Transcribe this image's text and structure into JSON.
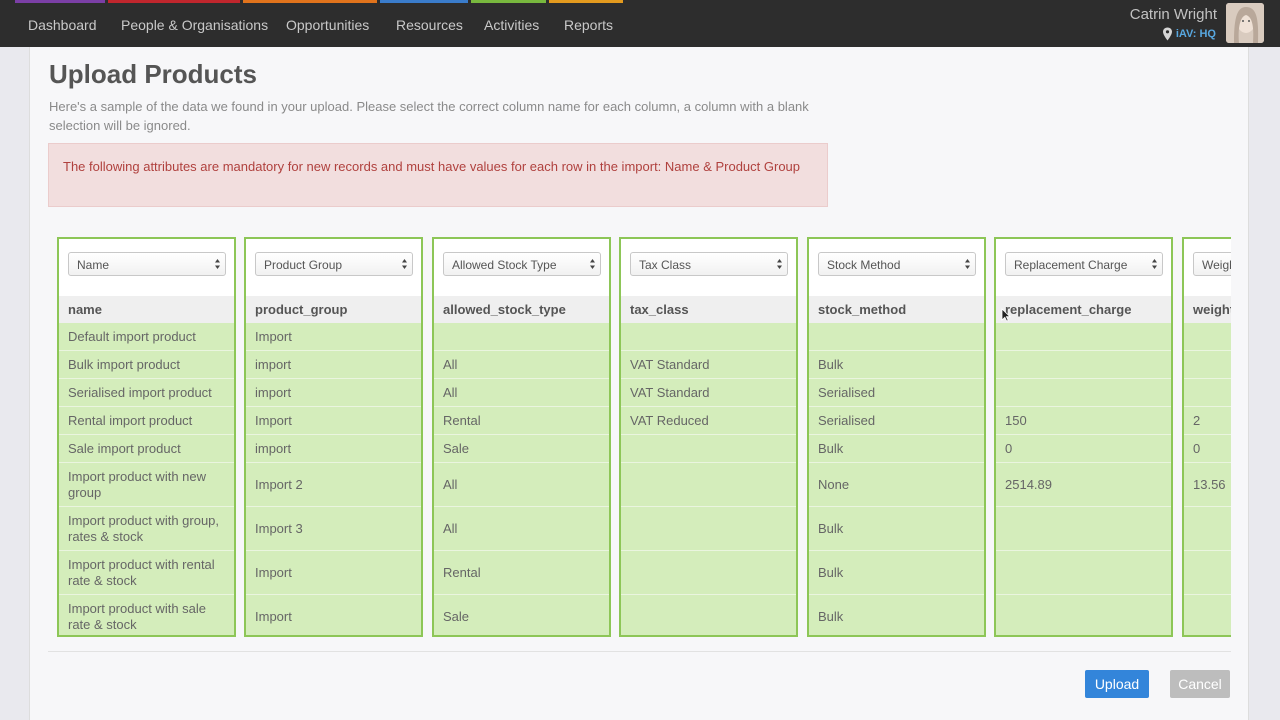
{
  "nav": {
    "items": [
      "Dashboard",
      "People & Organisations",
      "Opportunities",
      "Resources",
      "Activities",
      "Reports"
    ],
    "strip_colors": [
      "#7b3fa6",
      "#c0262d",
      "#e0731c",
      "#3a7ccb",
      "#78b83e",
      "#e39a1e"
    ],
    "user_name": "Catrin Wright",
    "user_location": "iAV: HQ"
  },
  "page": {
    "title": "Upload Products",
    "intro": "Here's a sample of the data we found in your upload. Please select the correct column name for each column, a column with a blank selection will be ignored.",
    "alert": "The following attributes are mandatory for new records and must have values for each row in the import: Name & Product Group"
  },
  "columns": [
    {
      "select": "Name",
      "field": "name",
      "cells": [
        "Default import product",
        "Bulk import product",
        "Serialised import product",
        "Rental import product",
        "Sale import product",
        "Import product with new group",
        "Import product with group, rates & stock",
        "Import product with rental rate & stock",
        "Import product with sale rate & stock"
      ]
    },
    {
      "select": "Product Group",
      "field": "product_group",
      "cells": [
        "Import",
        "import",
        "import",
        "Import",
        "import",
        "Import 2",
        "Import 3",
        "Import",
        "Import"
      ]
    },
    {
      "select": "Allowed Stock Type",
      "field": "allowed_stock_type",
      "cells": [
        "",
        "All",
        "All",
        "Rental",
        "Sale",
        "All",
        "All",
        "Rental",
        "Sale"
      ]
    },
    {
      "select": "Tax Class",
      "field": "tax_class",
      "cells": [
        "",
        "VAT Standard",
        "VAT Standard",
        "VAT Reduced",
        "",
        "",
        "",
        "",
        ""
      ]
    },
    {
      "select": "Stock Method",
      "field": "stock_method",
      "cells": [
        "",
        "Bulk",
        "Serialised",
        "Serialised",
        "Bulk",
        "None",
        "Bulk",
        "Bulk",
        "Bulk"
      ]
    },
    {
      "select": "Replacement Charge",
      "field": "replacement_charge",
      "cells": [
        "",
        "",
        "",
        "150",
        "0",
        "2514.89",
        "",
        "",
        ""
      ]
    },
    {
      "select": "Weight",
      "field": "weight",
      "cells": [
        "",
        "",
        "",
        "2",
        "0",
        "13.56",
        "",
        "",
        ""
      ]
    }
  ],
  "buttons": {
    "upload": "Upload",
    "cancel": "Cancel"
  }
}
